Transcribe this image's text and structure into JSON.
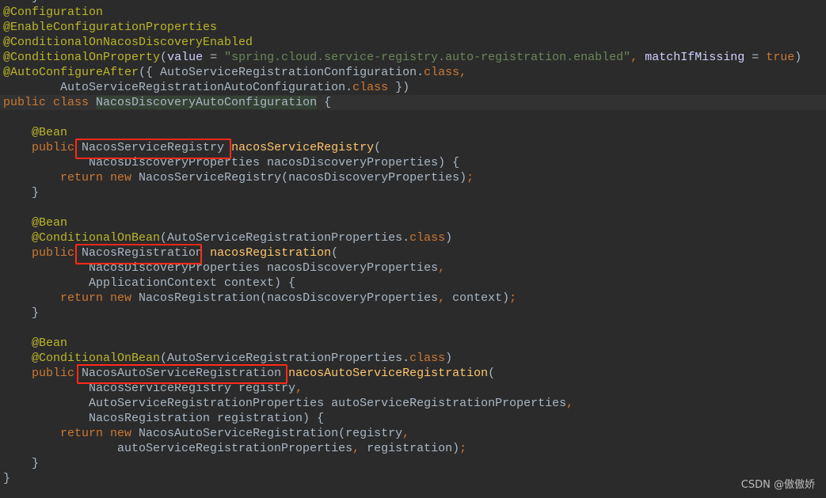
{
  "code_lines": [
    [
      [
        "    }",
        "plain"
      ]
    ],
    [
      [
        "@Configuration",
        "ann"
      ]
    ],
    [
      [
        "@EnableConfigurationProperties",
        "ann"
      ]
    ],
    [
      [
        "@ConditionalOnNacosDiscoveryEnabled",
        "ann"
      ]
    ],
    [
      [
        "@ConditionalOnProperty",
        "ann"
      ],
      [
        "(",
        "plain"
      ],
      [
        "value",
        "param"
      ],
      [
        " = ",
        "plain"
      ],
      [
        "\"spring.cloud.service-registry.auto-registration.enabled\"",
        "str"
      ],
      [
        ", ",
        "kw"
      ],
      [
        "matchIfMissing",
        "param"
      ],
      [
        " = ",
        "plain"
      ],
      [
        "true",
        "kw"
      ],
      [
        ")",
        "plain"
      ]
    ],
    [
      [
        "@AutoConfigureAfter",
        "ann"
      ],
      [
        "({ AutoServiceRegistrationConfiguration.",
        "plain"
      ],
      [
        "class",
        "kw"
      ],
      [
        ",",
        "kw"
      ]
    ],
    [
      [
        "        AutoServiceRegistrationAutoConfiguration.",
        "plain"
      ],
      [
        "class",
        "kw"
      ],
      [
        " })",
        "plain"
      ]
    ],
    [
      [
        "public class ",
        "kw"
      ],
      [
        "NacosDiscoveryAutoConfiguration",
        "hl"
      ],
      [
        " {",
        "plain"
      ]
    ],
    [
      [
        "",
        "plain"
      ]
    ],
    [
      [
        "    ",
        "plain"
      ],
      [
        "@Bean",
        "ann"
      ]
    ],
    [
      [
        "    ",
        "plain"
      ],
      [
        "public ",
        "kw"
      ],
      [
        "NacosServiceRegistry ",
        "plain"
      ],
      [
        "nacosServiceRegistry",
        "decl"
      ],
      [
        "(",
        "plain"
      ]
    ],
    [
      [
        "            NacosDiscoveryProperties nacosDiscoveryProperties) {",
        "plain"
      ]
    ],
    [
      [
        "        ",
        "plain"
      ],
      [
        "return new ",
        "kw"
      ],
      [
        "NacosServiceRegistry(nacosDiscoveryProperties)",
        "plain"
      ],
      [
        ";",
        "kw"
      ]
    ],
    [
      [
        "    }",
        "plain"
      ]
    ],
    [
      [
        "",
        "plain"
      ]
    ],
    [
      [
        "    ",
        "plain"
      ],
      [
        "@Bean",
        "ann"
      ]
    ],
    [
      [
        "    ",
        "plain"
      ],
      [
        "@ConditionalOnBean",
        "ann"
      ],
      [
        "(AutoServiceRegistrationProperties.",
        "plain"
      ],
      [
        "class",
        "kw"
      ],
      [
        ")",
        "plain"
      ]
    ],
    [
      [
        "    ",
        "plain"
      ],
      [
        "public ",
        "kw"
      ],
      [
        "NacosRegistration ",
        "plain"
      ],
      [
        "nacosRegistration",
        "decl"
      ],
      [
        "(",
        "plain"
      ]
    ],
    [
      [
        "            NacosDiscoveryProperties nacosDiscoveryProperties",
        "plain"
      ],
      [
        ",",
        "kw"
      ]
    ],
    [
      [
        "            ApplicationContext context) {",
        "plain"
      ]
    ],
    [
      [
        "        ",
        "plain"
      ],
      [
        "return new ",
        "kw"
      ],
      [
        "NacosRegistration(nacosDiscoveryProperties",
        "plain"
      ],
      [
        ", ",
        "kw"
      ],
      [
        "context)",
        "plain"
      ],
      [
        ";",
        "kw"
      ]
    ],
    [
      [
        "    }",
        "plain"
      ]
    ],
    [
      [
        "",
        "plain"
      ]
    ],
    [
      [
        "    ",
        "plain"
      ],
      [
        "@Bean",
        "ann"
      ]
    ],
    [
      [
        "    ",
        "plain"
      ],
      [
        "@ConditionalOnBean",
        "ann"
      ],
      [
        "(AutoServiceRegistrationProperties.",
        "plain"
      ],
      [
        "class",
        "kw"
      ],
      [
        ")",
        "plain"
      ]
    ],
    [
      [
        "    ",
        "plain"
      ],
      [
        "public ",
        "kw"
      ],
      [
        "NacosAutoServiceRegistration ",
        "plain"
      ],
      [
        "nacosAutoServiceRegistration",
        "decl"
      ],
      [
        "(",
        "plain"
      ]
    ],
    [
      [
        "            NacosServiceRegistry registry",
        "plain"
      ],
      [
        ",",
        "kw"
      ]
    ],
    [
      [
        "            AutoServiceRegistrationProperties autoServiceRegistrationProperties",
        "plain"
      ],
      [
        ",",
        "kw"
      ]
    ],
    [
      [
        "            NacosRegistration registration) {",
        "plain"
      ]
    ],
    [
      [
        "        ",
        "plain"
      ],
      [
        "return new ",
        "kw"
      ],
      [
        "NacosAutoServiceRegistration(registry",
        "plain"
      ],
      [
        ",",
        "kw"
      ]
    ],
    [
      [
        "                autoServiceRegistrationProperties",
        "plain"
      ],
      [
        ", ",
        "kw"
      ],
      [
        "registration)",
        "plain"
      ],
      [
        ";",
        "kw"
      ]
    ],
    [
      [
        "    }",
        "plain"
      ]
    ],
    [
      [
        "}",
        "plain"
      ]
    ]
  ],
  "current_line_index": 7,
  "watermark": "CSDN @傲傲娇",
  "colors": {
    "background": "#2b2b2b",
    "keyword": "#cc7832",
    "annotation": "#bbb529",
    "string": "#6a8759",
    "text": "#a9b7c6",
    "highlight_box": "#ff2a1a"
  }
}
